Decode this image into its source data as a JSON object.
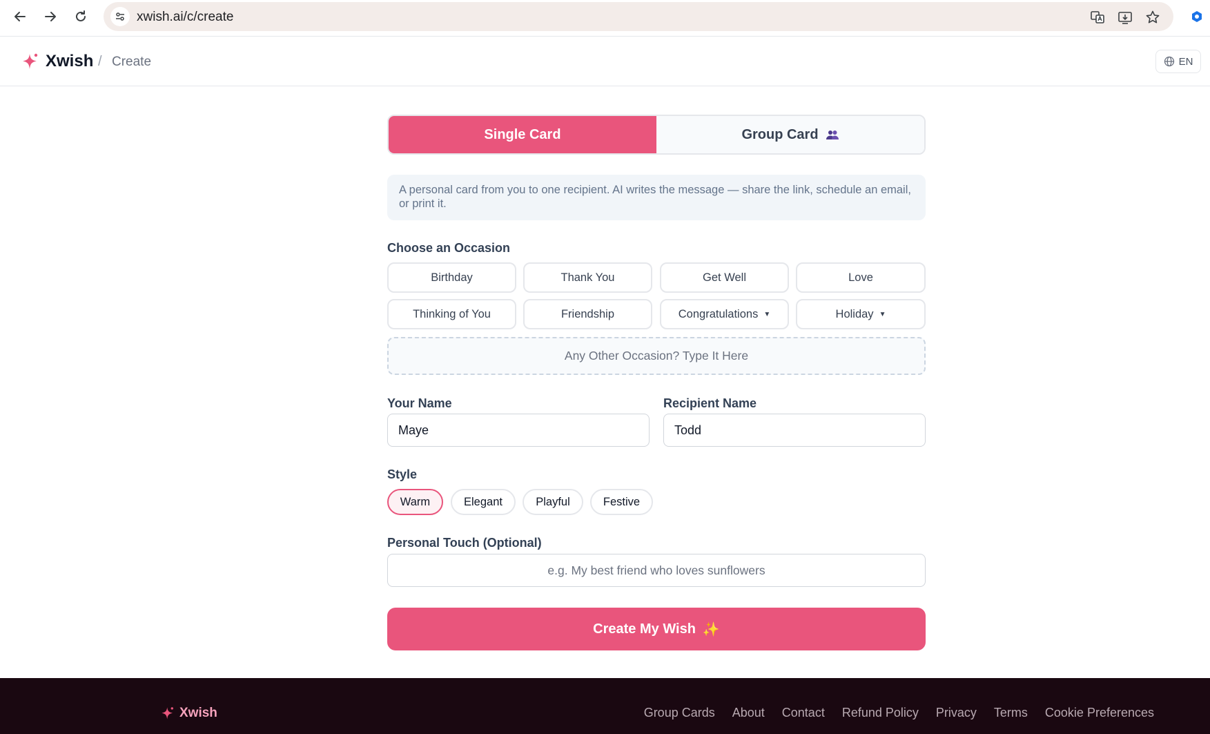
{
  "browser": {
    "url": "xwish.ai/c/create"
  },
  "header": {
    "logo_text": "Xwish",
    "breadcrumb_separator": "/",
    "breadcrumb": "Create",
    "language": "EN"
  },
  "tabs": [
    {
      "label": "Single Card",
      "active": true
    },
    {
      "label": "Group Card",
      "active": false
    }
  ],
  "info_text": "A personal card from you to one recipient. AI writes the message — share the link, schedule an email, or print it.",
  "occasion": {
    "label": "Choose an Occasion",
    "options": [
      "Birthday",
      "Thank You",
      "Get Well",
      "Love",
      "Thinking of You",
      "Friendship",
      "Congratulations",
      "Holiday"
    ],
    "other_placeholder": "Any Other Occasion? Type It Here"
  },
  "names": {
    "your_label": "Your Name",
    "your_value": "Maye",
    "recipient_label": "Recipient Name",
    "recipient_value": "Todd"
  },
  "style": {
    "label": "Style",
    "options": [
      "Warm",
      "Elegant",
      "Playful",
      "Festive"
    ],
    "selected": "Warm"
  },
  "personal_touch": {
    "label": "Personal Touch (Optional)",
    "placeholder": "e.g. My best friend who loves sunflowers"
  },
  "create_button": {
    "label": "Create My Wish",
    "emoji": "✨"
  },
  "footer": {
    "logo_text": "Xwish",
    "links": [
      "Group Cards",
      "About",
      "Contact",
      "Refund Policy",
      "Privacy",
      "Terms",
      "Cookie Preferences"
    ]
  },
  "colors": {
    "accent": "#e9557c",
    "footer_bg": "#1a0811",
    "footer_logo": "#f7a3bd"
  }
}
